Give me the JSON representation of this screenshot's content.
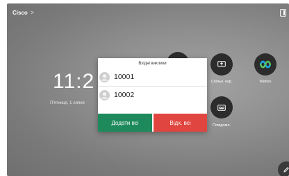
{
  "topbar": {
    "brand": "Cisco",
    "chevron": ">"
  },
  "home": {
    "clock": "11:2",
    "date": "П'ятниця, 1 липня"
  },
  "apps": [
    {
      "label": "Спільн. екр.",
      "icon": "share-screen-icon"
    },
    {
      "label": "Webex",
      "icon": "webex-logo-icon"
    },
    {
      "label": "Повідомл.",
      "icon": "voicemail-icon"
    }
  ],
  "dialog": {
    "title": "Вхідні виклики",
    "calls": [
      {
        "number": "10001"
      },
      {
        "number": "10002"
      }
    ],
    "accept_all": "Додати всі",
    "decline_all": "Відх. всі"
  },
  "colors": {
    "accept": "#1e8a5c",
    "decline": "#e0463f",
    "button_bg": "#2c2c2c",
    "webex_blue": "#1aa8e6",
    "webex_green": "#59c264"
  }
}
